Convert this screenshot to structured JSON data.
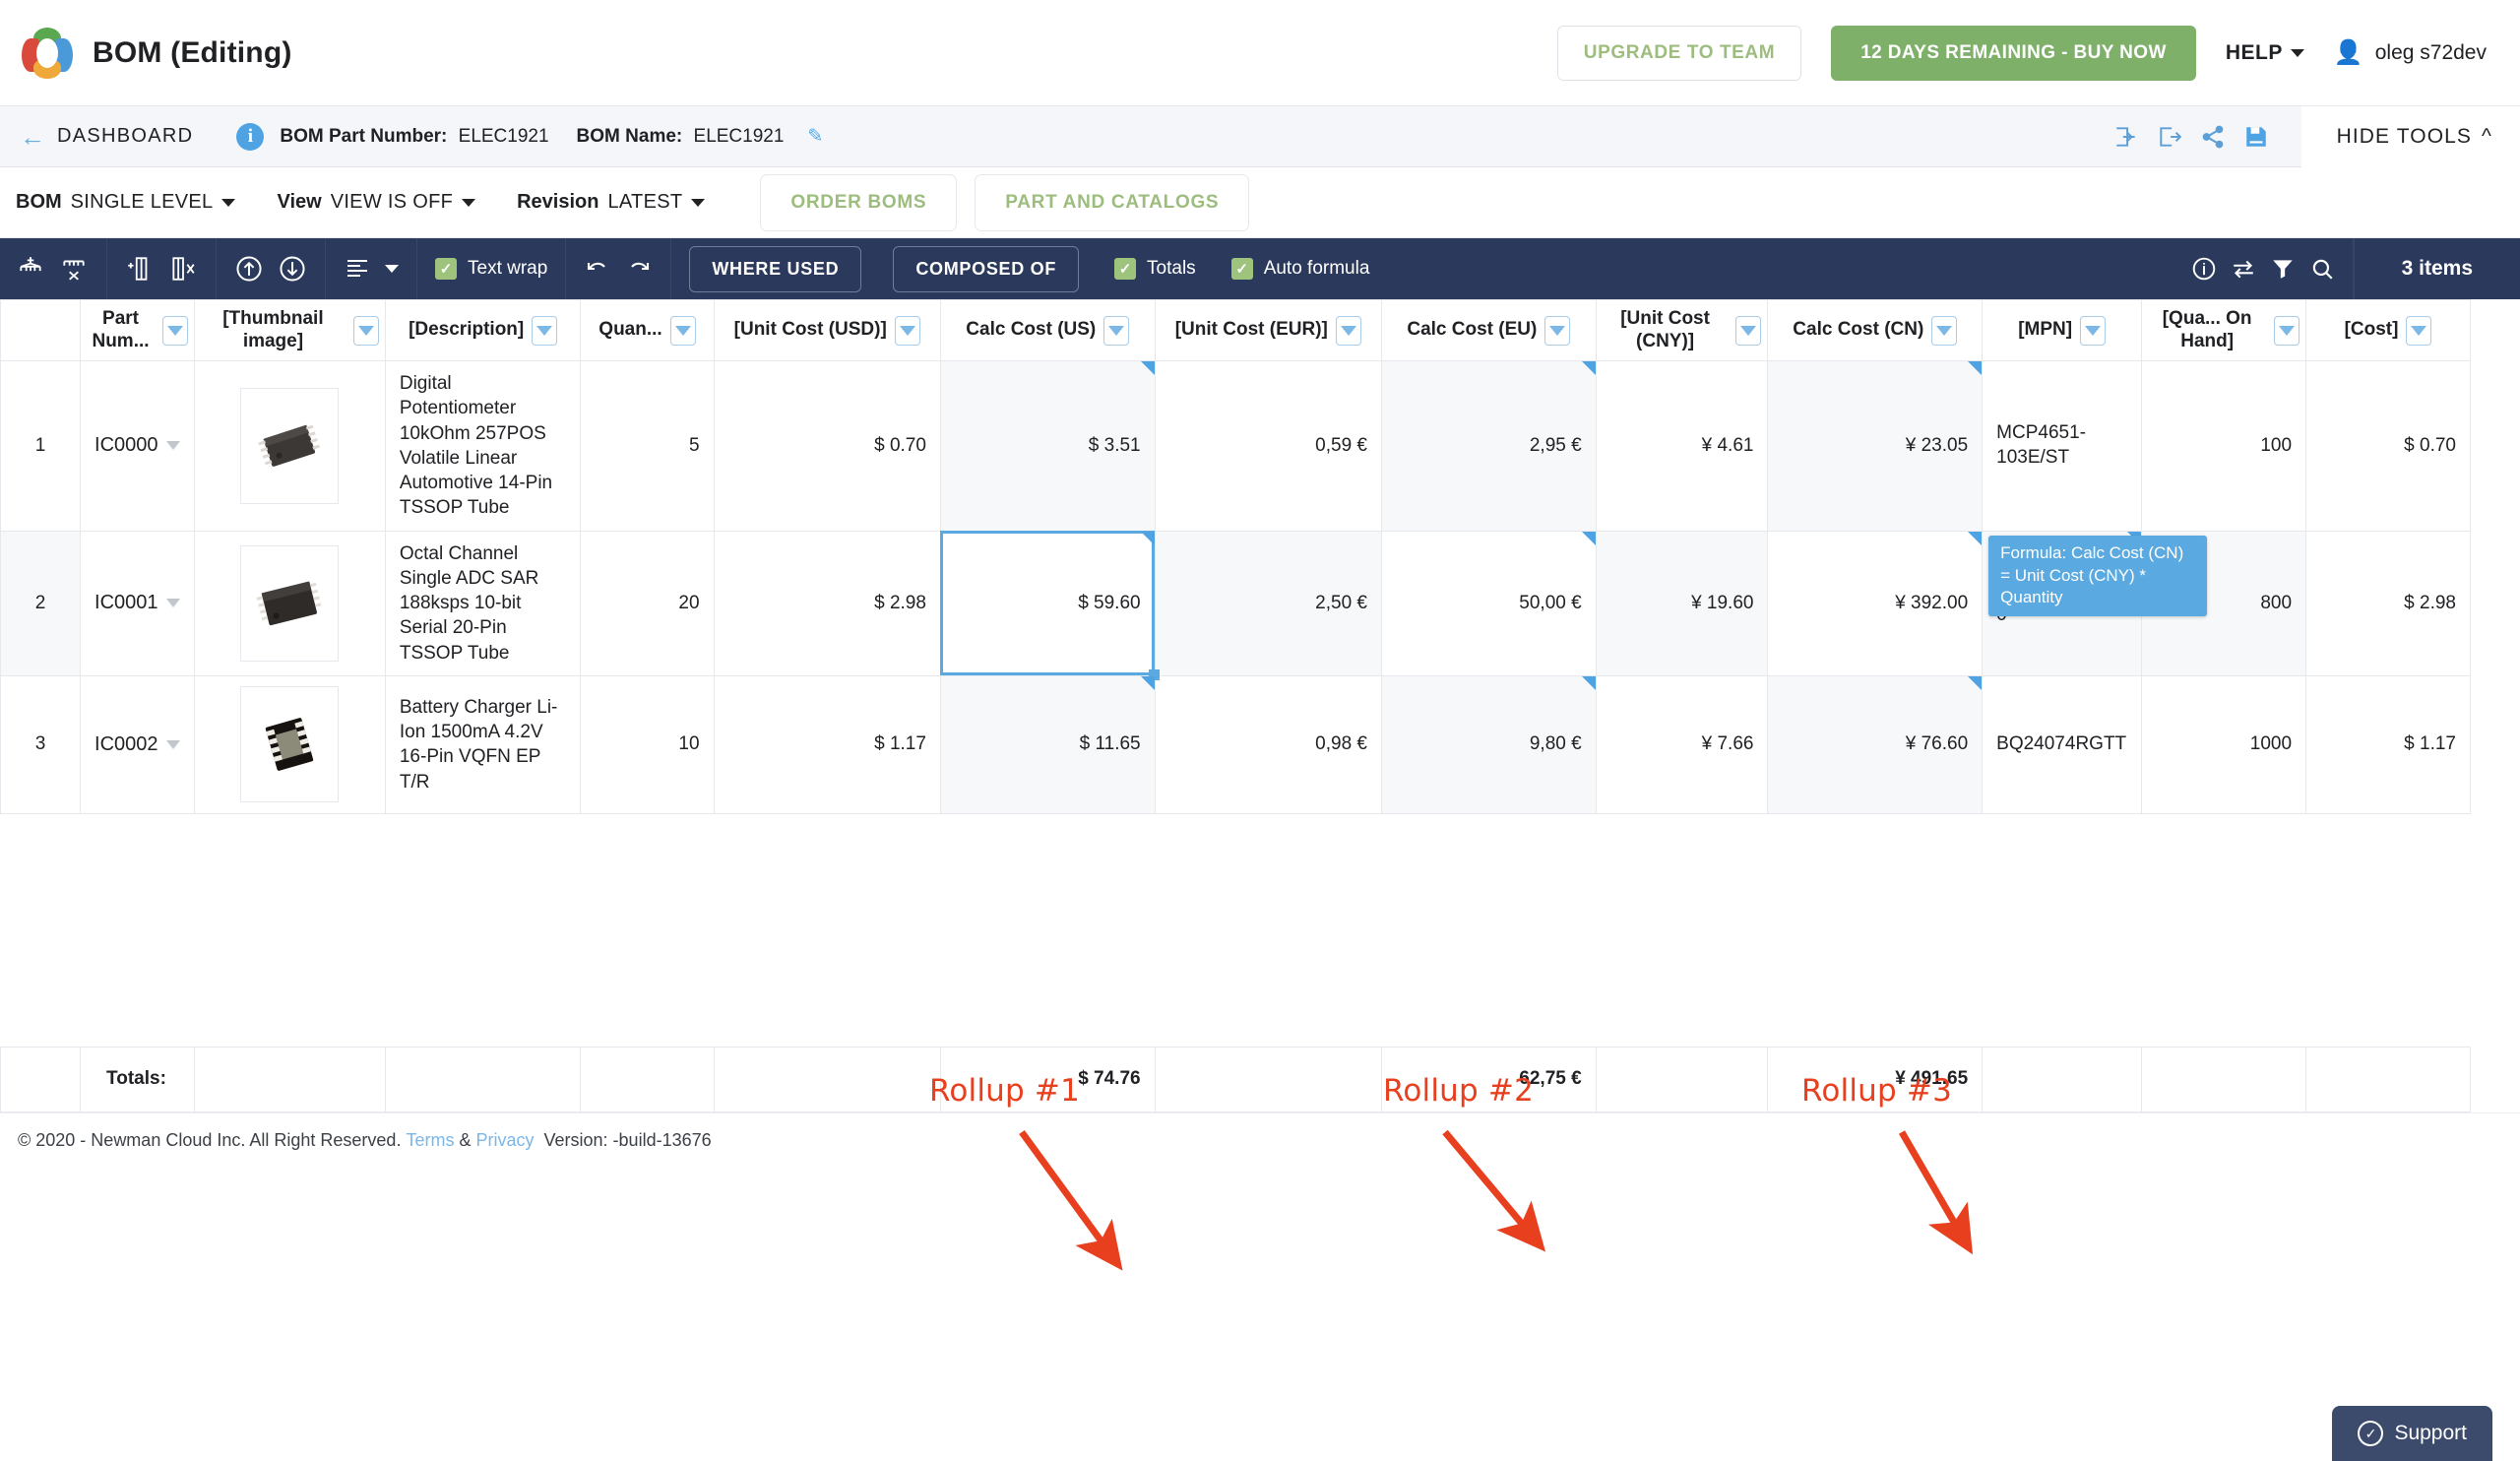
{
  "header": {
    "app_title": "BOM (Editing)",
    "logo_icon": "pie-logo-icon",
    "upgrade_label": "UPGRADE TO TEAM",
    "buy_label": "12 DAYS REMAINING - BUY NOW",
    "help_label": "HELP",
    "user_name": "oleg s72dev",
    "user_icon": "person-icon",
    "accent_green": "#7fb069",
    "accent_blue": "#4fa3e3"
  },
  "subheader": {
    "back_label": "DASHBOARD",
    "back_icon": "arrow-left-icon",
    "info_icon": "info-circle-icon",
    "bom_part_number_label": "BOM Part Number:",
    "bom_part_number_value": "ELEC1921",
    "bom_name_label": "BOM Name:",
    "bom_name_value": "ELEC1921",
    "edit_icon": "pencil-icon",
    "icons": [
      "import-icon",
      "export-icon",
      "share-icon",
      "save-icon"
    ],
    "hide_tools_label": "HIDE TOOLS",
    "hide_tools_icon": "chevron-up-icon"
  },
  "actionbar": {
    "bom_label": "BOM",
    "bom_value": "SINGLE LEVEL",
    "view_label": "View",
    "view_value": "VIEW IS OFF",
    "revision_label": "Revision",
    "revision_value": "LATEST",
    "order_boms_label": "ORDER BOMS",
    "part_catalogs_label": "PART AND CATALOGS"
  },
  "toolbar": {
    "icons_group1": [
      "add-assembly-icon",
      "delete-assembly-icon"
    ],
    "icons_group2": [
      "add-column-icon",
      "delete-column-icon"
    ],
    "icons_group3": [
      "move-up-icon",
      "move-down-icon"
    ],
    "icons_group4": [
      "align-icon"
    ],
    "text_wrap_label": "Text wrap",
    "undo_icon": "undo-icon",
    "redo_icon": "redo-icon",
    "where_used_label": "WHERE USED",
    "composed_of_label": "COMPOSED OF",
    "totals_label": "Totals",
    "auto_formula_label": "Auto formula",
    "right_icons": [
      "info-icon",
      "swap-icon",
      "filter-icon",
      "search-icon"
    ],
    "items_count": "3 items"
  },
  "table": {
    "columns": [
      {
        "label": "",
        "key": "idx"
      },
      {
        "label": "Part Num...",
        "key": "pn"
      },
      {
        "label": "[Thumbnail image]",
        "key": "thumb"
      },
      {
        "label": "[Description]",
        "key": "desc"
      },
      {
        "label": "Quan...",
        "key": "qty"
      },
      {
        "label": "[Unit Cost (USD)]",
        "key": "ucusd"
      },
      {
        "label": "Calc Cost (US)",
        "key": "ccus"
      },
      {
        "label": "[Unit Cost (EUR)]",
        "key": "uceur"
      },
      {
        "label": "Calc Cost (EU)",
        "key": "cceu"
      },
      {
        "label": "[Unit Cost (CNY)]",
        "key": "uccny"
      },
      {
        "label": "Calc Cost (CN)",
        "key": "cccn"
      },
      {
        "label": "[MPN]",
        "key": "mpn"
      },
      {
        "label": "[Qua... On Hand]",
        "key": "qoh"
      },
      {
        "label": "[Cost]",
        "key": "cost"
      }
    ],
    "rows": [
      {
        "idx": "1",
        "pn": "IC0000",
        "desc": "Digital Potentiometer 10kOhm 257POS Volatile Linear Automotive 14-Pin TSSOP Tube",
        "qty": "5",
        "ucusd": "$ 0.70",
        "ccus": "$ 3.51",
        "uceur": "0,59 €",
        "cceu": "2,95 €",
        "uccny": "¥ 4.61",
        "cccn": "¥ 23.05",
        "mpn": "MCP4651-103E/ST",
        "qoh": "100",
        "cost": "$ 0.70"
      },
      {
        "idx": "2",
        "pn": "IC0001",
        "desc": "Octal Channel Single ADC SAR 188ksps 10-bit Serial 20-Pin TSSOP Tube",
        "qty": "20",
        "ucusd": "$ 2.98",
        "ccus": "$ 59.60",
        "uceur": "2,50 €",
        "cceu": "50,00 €",
        "uccny": "¥ 19.60",
        "cccn": "¥ 392.00",
        "mpn": "AD7997BRUZ-0",
        "qoh": "800",
        "cost": "$ 2.98"
      },
      {
        "idx": "3",
        "pn": "IC0002",
        "desc": "Battery Charger Li-Ion 1500mA 4.2V 16-Pin VQFN EP T/R",
        "qty": "10",
        "ucusd": "$ 1.17",
        "ccus": "$ 11.65",
        "uceur": "0,98 €",
        "cceu": "9,80 €",
        "uccny": "¥ 7.66",
        "cccn": "¥ 76.60",
        "mpn": "BQ24074RGTT",
        "qoh": "1000",
        "cost": "$ 1.17"
      }
    ],
    "totals_label": "Totals:",
    "totals": {
      "ccus": "$ 74.76",
      "cceu": "62,75 €",
      "cccn": "¥ 491.65"
    }
  },
  "tooltip": {
    "text": "Formula: Calc Cost (CN) = Unit Cost (CNY) * Quantity",
    "color": "#5aa9e0"
  },
  "annotations": {
    "color": "#e8401f",
    "labels": [
      "Rollup #1",
      "Rollup #2",
      "Rollup #3"
    ]
  },
  "footer": {
    "copyright": "© 2020 - Newman Cloud Inc. All Right Reserved.",
    "terms": "Terms",
    "amp": "&",
    "privacy": "Privacy",
    "version": "Version: -build-13676",
    "support_label": "Support",
    "support_icon": "check-circle-icon"
  }
}
